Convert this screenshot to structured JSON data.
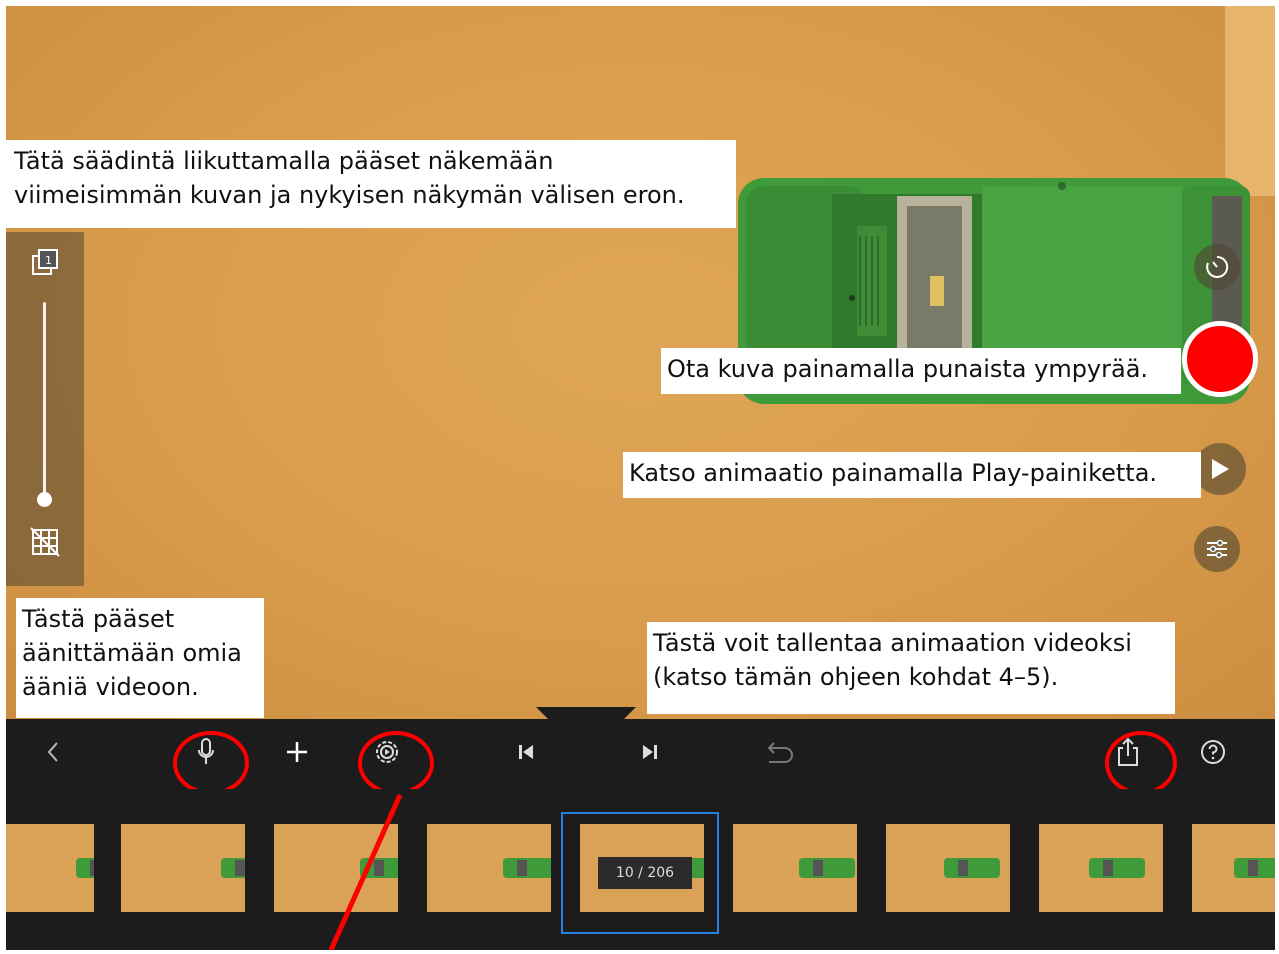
{
  "annotations": {
    "onion_skin": "Tätä säädintä liikuttamalla pääset näkemään\nviimeisimmän kuvan ja nykyisen näkymän välisen eron.",
    "shutter": "Ota kuva painamalla punaista ympyrää.",
    "play": "Katso animaatio painamalla Play-painiketta.",
    "audio": "Tästä pääset\näänittämään omia\nääniä videoon.",
    "export": "Tästä voit tallentaa animaation videoksi\n(katso tämän ohjeen kohdat 4–5)."
  },
  "filmstrip": {
    "frame_counter": "10 / 206",
    "current_frame": 10,
    "total_frames": 206
  },
  "colors": {
    "shutter": "#ff0000",
    "annotation_ring": "#ff0000",
    "selection": "#2a7de1",
    "toolbar": "#1c1c1c",
    "background_paper": "#d89c4c"
  },
  "icons": {
    "onion_frame": "onion-skin-frame-icon",
    "grid": "grid-off-icon",
    "timer": "timer-icon",
    "play": "play-icon",
    "capture_settings": "sliders-icon",
    "back": "chevron-left-icon",
    "microphone": "microphone-icon",
    "add": "plus-icon",
    "settings": "gear-icon",
    "first_frame": "skip-to-start-icon",
    "last_frame": "skip-to-end-icon",
    "undo": "undo-icon",
    "share": "share-icon",
    "help": "help-icon"
  },
  "onion_slider": {
    "level": 0.0
  }
}
